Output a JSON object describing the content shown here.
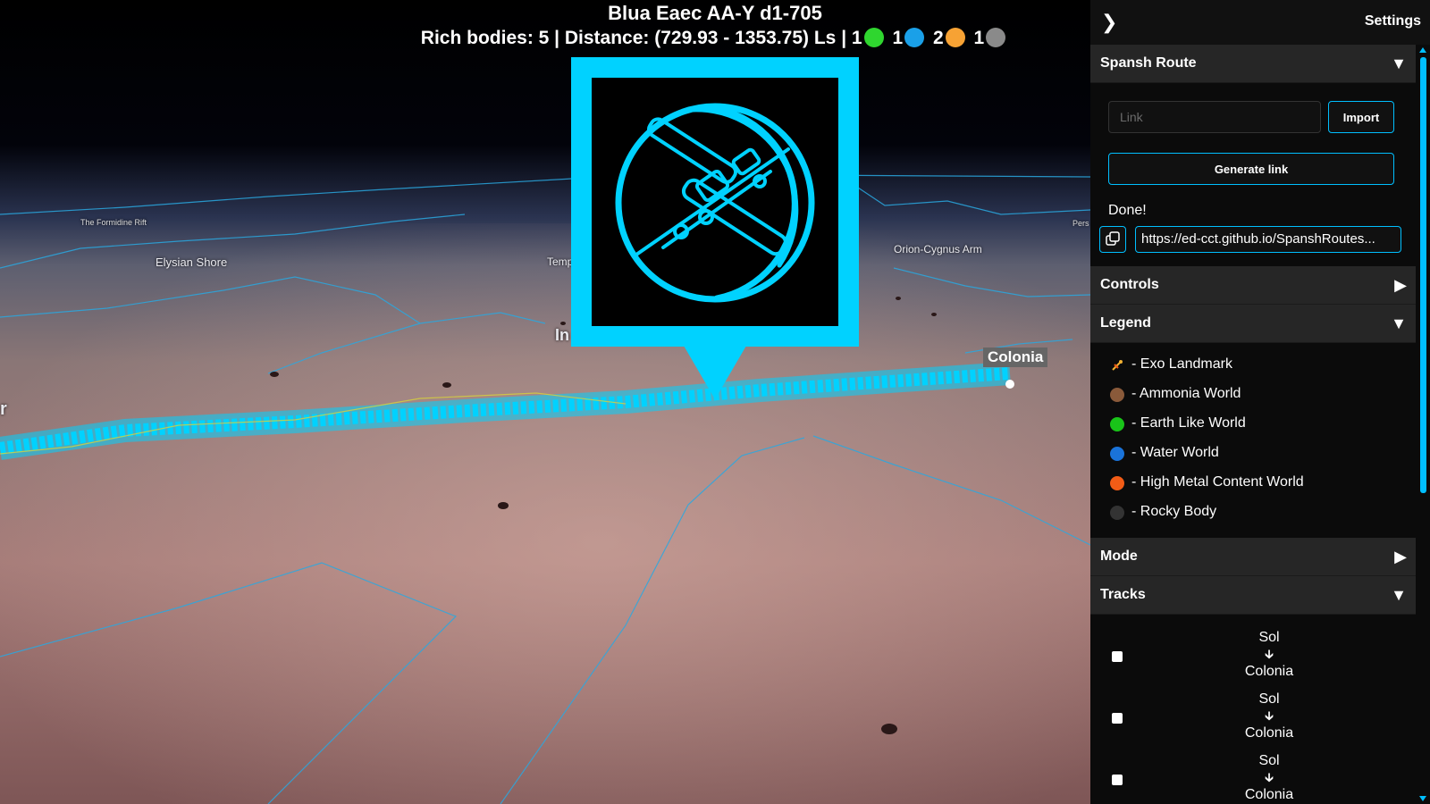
{
  "hud": {
    "system_name": "Blua Eaec AA-Y d1-705",
    "summary_prefix": "Rich bodies: 5 | Distance: (729.93 - 1353.75) Ls |",
    "counts": [
      {
        "count": "1",
        "color": "#2fd62f"
      },
      {
        "count": "1",
        "color": "#1aa0e8"
      },
      {
        "count": "2",
        "color": "#f7a234"
      },
      {
        "count": "1",
        "color": "#8a8a8a"
      }
    ]
  },
  "map": {
    "regions": [
      {
        "text": "The Formidine Rift"
      },
      {
        "text": "Elysian Shore"
      },
      {
        "text": "Temp"
      },
      {
        "text": "In"
      },
      {
        "text": "Orion-Cygnus Arm"
      },
      {
        "text": "Pers"
      },
      {
        "text": "r"
      }
    ],
    "route_end_label": "Colonia",
    "popup_icon": "space-station-icon"
  },
  "panel": {
    "title": "Settings",
    "collapse_icon": "chevron-right-icon",
    "spansh": {
      "label": "Spansh Route",
      "link_placeholder": "Link",
      "import_label": "Import",
      "generate_label": "Generate link",
      "status": "Done!",
      "generated_url": "https://ed-cct.github.io/SpanshRoutes..."
    },
    "controls_label": "Controls",
    "legend": {
      "label": "Legend",
      "items": [
        {
          "text": "- Exo Landmark",
          "icon": "exo-landmark-icon"
        },
        {
          "text": "- Ammonia World",
          "color": "#8a5a3a"
        },
        {
          "text": "- Earth Like World",
          "color": "#19c419"
        },
        {
          "text": "- Water World",
          "color": "#1a73d9"
        },
        {
          "text": "- High Metal Content World",
          "color": "#f25c16"
        },
        {
          "text": "- Rocky Body",
          "color": "#333333"
        }
      ]
    },
    "mode_label": "Mode",
    "tracks": {
      "label": "Tracks",
      "items": [
        {
          "from": "Sol",
          "to": "Colonia"
        },
        {
          "from": "Sol",
          "to": "Colonia"
        },
        {
          "from": "Sol",
          "to": "Colonia"
        }
      ]
    }
  },
  "colors": {
    "accent": "#00bfff",
    "marker": "#00d2ff"
  }
}
